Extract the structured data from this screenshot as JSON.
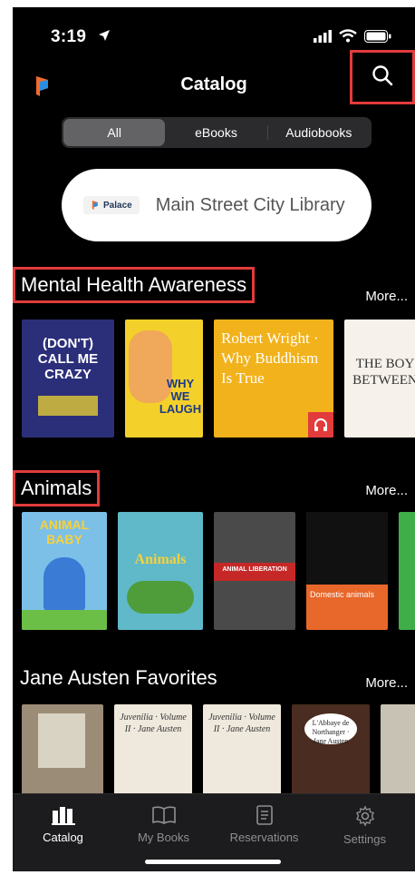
{
  "status": {
    "time": "3:19"
  },
  "nav": {
    "title": "Catalog"
  },
  "segments": [
    "All",
    "eBooks",
    "Audiobooks"
  ],
  "library": {
    "badge": "Palace",
    "name": "Main Street City Library"
  },
  "lanes": [
    {
      "title": "Mental Health Awareness",
      "more": "More...",
      "covers": [
        {
          "text": "(DON'T) CALL ME CRAZY",
          "bg": "#2b2f7a"
        },
        {
          "text": "WHY WE LAUGH",
          "bg": "#f4d02a"
        },
        {
          "text": "Robert Wright · Why Buddhism Is True",
          "bg": "#f2b21b"
        },
        {
          "text": "THE BOY BETWEEN",
          "bg": "#f6f1ea"
        }
      ]
    },
    {
      "title": "Animals",
      "more": "More...",
      "covers": [
        {
          "text": "ANIMAL BABY",
          "bg": "#7cc0e8"
        },
        {
          "text": "Animals",
          "bg": "#5fb9c9"
        },
        {
          "text": "ANIMAL LIBERATION",
          "bg": "#4a4a4a"
        },
        {
          "text": "Domestic animals",
          "bg": "#e8672a"
        },
        {
          "text": "",
          "bg": "#3fae49"
        }
      ]
    },
    {
      "title": "Jane Austen Favorites",
      "more": "More...",
      "covers": [
        {
          "text": "",
          "bg": "#9b8c78"
        },
        {
          "text": "Juvenilia · Volume II · Jane Austen",
          "bg": "#efe9dd"
        },
        {
          "text": "Juvenilia · Volume II · Jane Austen",
          "bg": "#efe9dd"
        },
        {
          "text": "L'Abbaye de Northanger · Jane Austen",
          "bg": "#4a2d20"
        },
        {
          "text": "",
          "bg": "#c8c2b4"
        }
      ]
    }
  ],
  "tabs": [
    "Catalog",
    "My Books",
    "Reservations",
    "Settings"
  ],
  "colors": {
    "highlight": "#e23b3b",
    "background": "#000000",
    "tabbar": "#1c1c1e"
  }
}
